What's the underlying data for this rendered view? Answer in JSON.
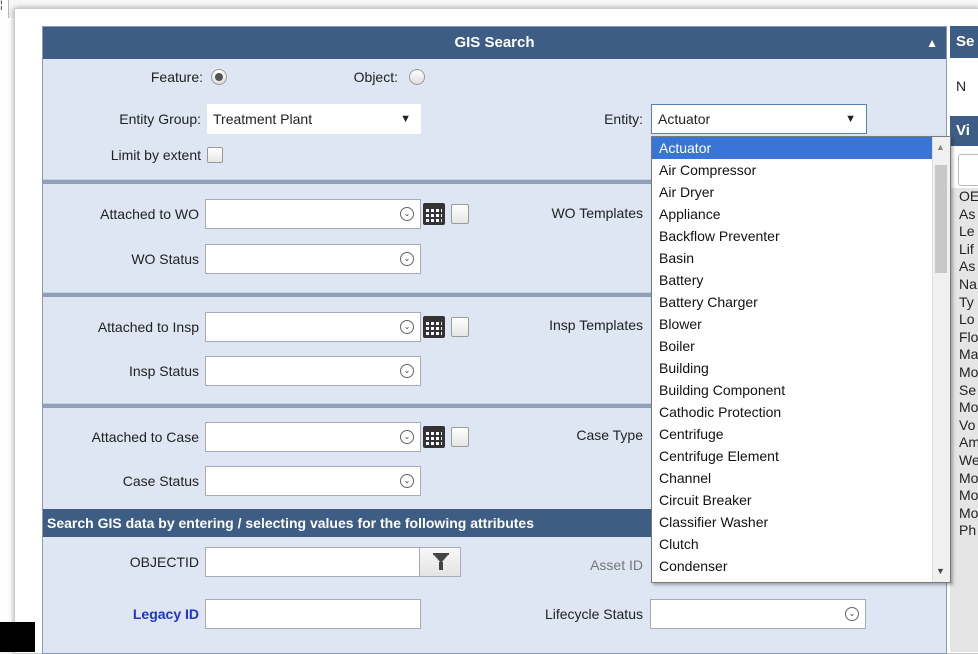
{
  "window": {
    "corner_glyph": "¦"
  },
  "gis_panel": {
    "title": "GIS Search",
    "feature_label": "Feature:",
    "object_label": "Object:",
    "entity_group_label": "Entity Group:",
    "entity_group_value": "Treatment Plant",
    "entity_label": "Entity:",
    "entity_value": "Actuator",
    "limit_label": "Limit by extent",
    "attached_wo_label": "Attached to WO",
    "wo_templates_label": "WO Templates",
    "wo_status_label": "WO Status",
    "attached_insp_label": "Attached to Insp",
    "insp_templates_label": "Insp Templates",
    "insp_status_label": "Insp Status",
    "attached_case_label": "Attached to Case",
    "case_type_label": "Case Type",
    "case_status_label": "Case Status",
    "search_header": "Search GIS data by entering / selecting values for the following attributes",
    "objectid_label": "OBJECTID",
    "asset_id_label": "Asset ID",
    "legacy_id_label": "Legacy ID",
    "lifecycle_label": "Lifecycle Status"
  },
  "entity_options": [
    "Actuator",
    "Air Compressor",
    "Air Dryer",
    "Appliance",
    "Backflow Preventer",
    "Basin",
    "Battery",
    "Battery Charger",
    "Blower",
    "Boiler",
    "Building",
    "Building Component",
    "Cathodic Protection",
    "Centrifuge",
    "Centrifuge Element",
    "Channel",
    "Circuit Breaker",
    "Classifier Washer",
    "Clutch",
    "Condenser"
  ],
  "right_panel": {
    "header": "Se",
    "n_text": "N",
    "header2": "Vi",
    "items": [
      "OE",
      "As",
      "Le",
      "Lif",
      "As",
      "Na",
      "Ty",
      "Lo",
      "Flo",
      "Ma",
      "Mo",
      "Se",
      "Mo",
      "Vo",
      "Am",
      "We",
      "Mo",
      "Mo",
      "Mo",
      "Ph"
    ]
  },
  "colors": {
    "header": "#3e5d84",
    "panel_bg": "#dde6f2",
    "selection": "#3875d7",
    "legacy_label": "#2233cc"
  }
}
